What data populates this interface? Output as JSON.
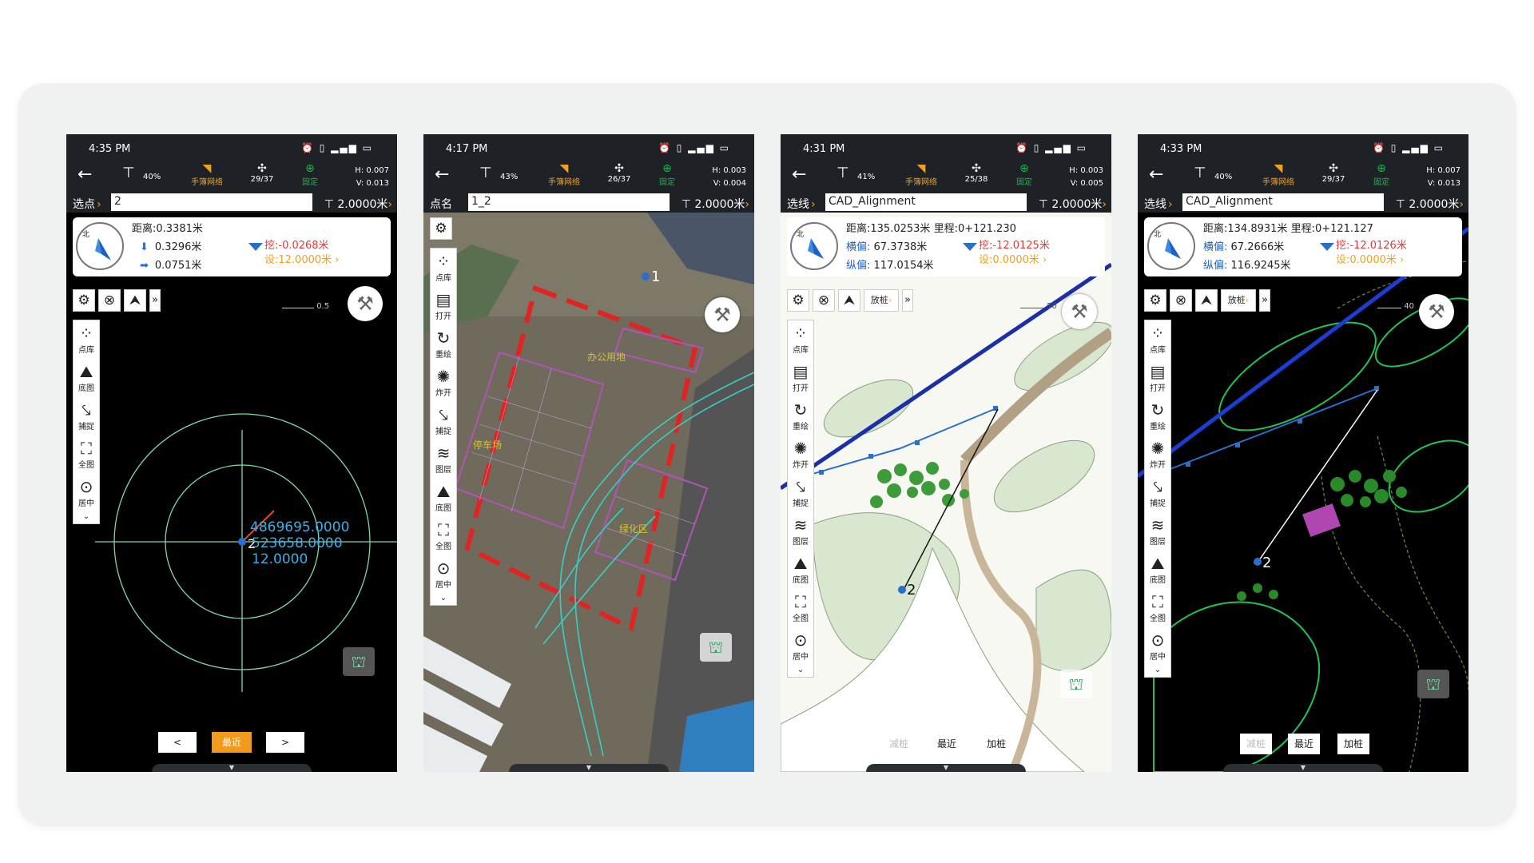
{
  "colors": {
    "card_bg": "#f0f1f1",
    "bar_bg": "#1e2227",
    "accent_orange": "#f29a1b",
    "cut_red": "#e23a3a",
    "fix_green": "#21b24b",
    "label_blue": "#1a62c7"
  },
  "sidebar_icons": {
    "point_library": "scatter-dots-icon",
    "dxf_open": "dxf-file-icon",
    "redraw": "refresh-icon",
    "explode": "explode-icon",
    "snap": "snap-pointer-icon",
    "layers": "layers-icon",
    "basemap": "basemap-icon",
    "full_view": "fullscreen-frame-icon",
    "center": "crosshair-icon"
  },
  "phones": [
    {
      "time": "4:35 PM",
      "battery": "40%",
      "network_label": "手簿网络",
      "satellites": "29/37",
      "fix_label": "固定",
      "h_precision": "H: 0.007",
      "v_precision": "V: 0.013",
      "point_label": "选点",
      "point_value": "2",
      "pole_height": "2.0000米",
      "info": {
        "distance": "距离:0.3381米",
        "line2_value": "0.3296米",
        "line3_value": "0.0751米",
        "cut_fill": "挖:-0.0268米",
        "design": "设:12.0000米"
      },
      "sidebar": [
        "点库",
        "底图",
        "捕捉",
        "全图",
        "居中"
      ],
      "scale_label": "0.5",
      "coords": [
        "4869695.0000",
        "523658.0000",
        "12.0000"
      ],
      "point_number": "2",
      "nav": [
        "<",
        "最近",
        ">"
      ]
    },
    {
      "time": "4:17 PM",
      "battery": "43%",
      "network_label": "手簿网络",
      "satellites": "26/37",
      "fix_label": "固定",
      "h_precision": "H: 0.003",
      "v_precision": "V: 0.004",
      "point_label": "点名",
      "point_value": "1_2",
      "pole_height": "2.0000米",
      "sidebar": [
        "点库",
        "打开",
        "重绘",
        "炸开",
        "捕捉",
        "图层",
        "底图",
        "全图",
        "居中"
      ],
      "point_number": "1",
      "map_labels": [
        "办公用地",
        "停车场",
        "绿化区"
      ]
    },
    {
      "time": "4:31 PM",
      "battery": "41%",
      "network_label": "手簿网络",
      "satellites": "25/38",
      "fix_label": "固定",
      "h_precision": "H: 0.003",
      "v_precision": "V: 0.005",
      "point_label": "选线",
      "point_value": "CAD_Alignment",
      "pole_height": "2.0000米",
      "info": {
        "distance": "距离:135.0253米",
        "chainage": "里程:0+121.230",
        "lateral_label": "横偏:",
        "lateral_value": "67.3738米",
        "longitudinal_label": "纵偏:",
        "longitudinal_value": "117.0154米",
        "cut_fill": "挖:-12.0125米",
        "design": "设:0.0000米"
      },
      "stake_label": "放桩",
      "sidebar": [
        "点库",
        "打开",
        "重绘",
        "炸开",
        "捕捉",
        "图层",
        "底图",
        "全图",
        "居中"
      ],
      "scale_label": "50",
      "point_number": "2",
      "nav": [
        "减桩",
        "最近",
        "加桩"
      ]
    },
    {
      "time": "4:33 PM",
      "battery": "40%",
      "network_label": "手簿网络",
      "satellites": "29/37",
      "fix_label": "固定",
      "h_precision": "H: 0.007",
      "v_precision": "V: 0.013",
      "point_label": "选线",
      "point_value": "CAD_Alignment",
      "pole_height": "2.0000米",
      "info": {
        "distance": "距离:134.8931米",
        "chainage": "里程:0+121.127",
        "lateral_label": "横偏:",
        "lateral_value": "67.2666米",
        "longitudinal_label": "纵偏:",
        "longitudinal_value": "116.9245米",
        "cut_fill": "挖:-12.0126米",
        "design": "设:0.0000米"
      },
      "stake_label": "放桩",
      "sidebar": [
        "点库",
        "打开",
        "重绘",
        "炸开",
        "捕捉",
        "图层",
        "底图",
        "全图",
        "居中"
      ],
      "scale_label": "40",
      "point_number": "2",
      "nav": [
        "减桩",
        "最近",
        "加桩"
      ]
    }
  ]
}
